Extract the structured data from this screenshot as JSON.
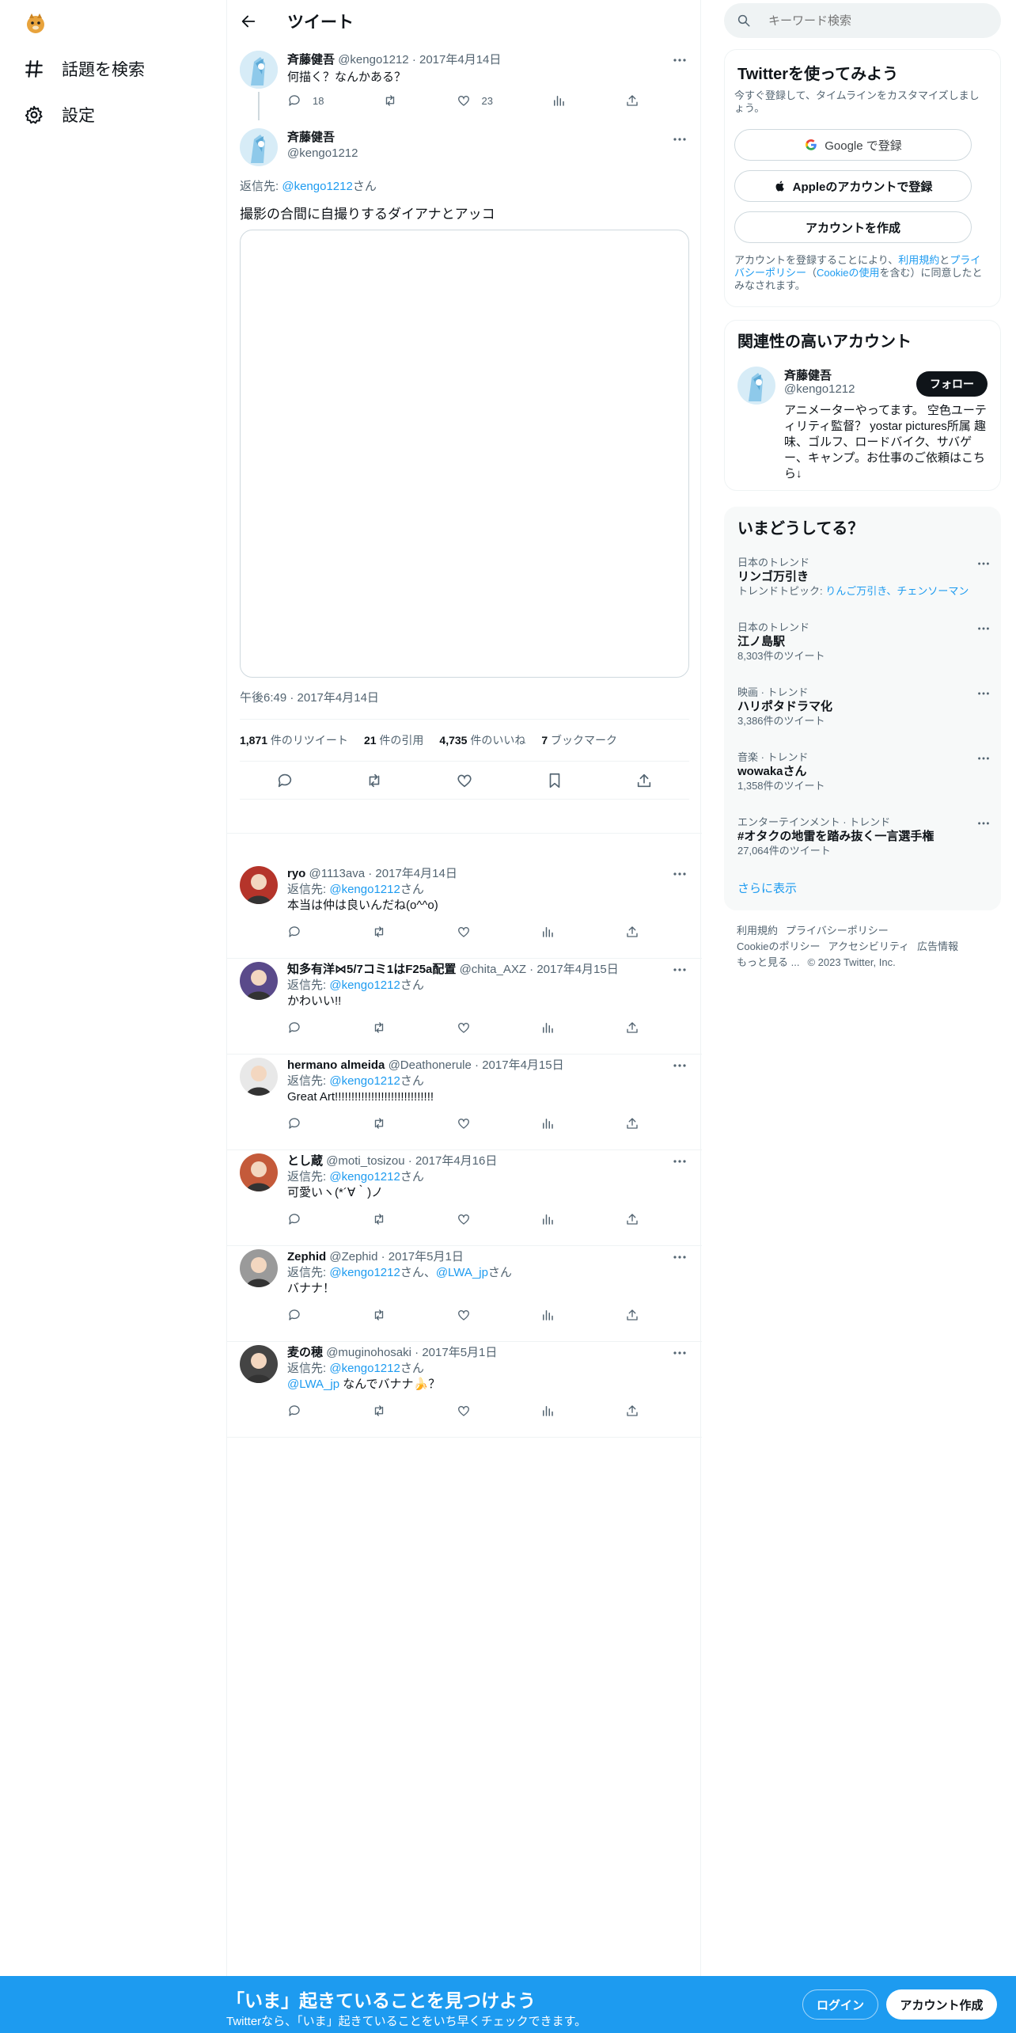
{
  "nav": {
    "explore_label": "話題を検索",
    "settings_label": "設定"
  },
  "header": {
    "title": "ツイート"
  },
  "parent_tweet": {
    "name": "斉藤健吾",
    "handle": "@kengo1212",
    "date": "2017年4月14日",
    "text": "何描く？なんかある？",
    "replies": "18",
    "likes": "23"
  },
  "main_tweet": {
    "name": "斉藤健吾",
    "handle": "@kengo1212",
    "reply_prefix": "返信先: ",
    "reply_to": "@kengo1212",
    "reply_suffix": "さん",
    "text": "撮影の合間に自撮りするダイアナとアッコ",
    "timestamp": "午後6:49 · 2017年4月14日",
    "retweets_n": "1,871",
    "retweets_l": " 件のリツイート",
    "quotes_n": "21",
    "quotes_l": " 件の引用",
    "likes_n": "4,735",
    "likes_l": " 件のいいね",
    "bookmarks_n": "7",
    "bookmarks_l": " ブックマーク"
  },
  "replies": [
    {
      "name": "ryo",
      "handle": "@1113ava",
      "date": "2017年4月14日",
      "reply_to": "@kengo1212",
      "reply_to2": "",
      "text": "本当は仲は良いんだね(o^^o)",
      "text_mention": "",
      "avatar": "#b5342a"
    },
    {
      "name": "知多有洋⋈5/7コミ1はF25a配置",
      "handle": "@chita_AXZ",
      "date": "2017年4月15日",
      "reply_to": "@kengo1212",
      "reply_to2": "",
      "text": "かわいい!!",
      "text_mention": "",
      "avatar": "#5a4a8a"
    },
    {
      "name": "hermano almeida",
      "handle": "@Deathonerule",
      "date": "2017年4月15日",
      "reply_to": "@kengo1212",
      "reply_to2": "",
      "text": "Great Art!!!!!!!!!!!!!!!!!!!!!!!!!!!!!!",
      "text_mention": "",
      "avatar": "#e8e8e8"
    },
    {
      "name": "とし蔵",
      "handle": "@moti_tosizou",
      "date": "2017年4月16日",
      "reply_to": "@kengo1212",
      "reply_to2": "",
      "text": "可愛いヽ(*´∀｀)ノ",
      "text_mention": "",
      "avatar": "#c45a3a"
    },
    {
      "name": "Zephid",
      "handle": "@Zephid",
      "date": "2017年5月1日",
      "reply_to": "@kengo1212",
      "reply_to2": "@LWA_jp",
      "text": "バナナ！",
      "text_mention": "",
      "avatar": "#9a9a9a"
    },
    {
      "name": "麦の穂",
      "handle": "@muginohosaki",
      "date": "2017年5月1日",
      "reply_to": "@kengo1212",
      "reply_to2": "",
      "text": " なんでバナナ🍌？",
      "text_mention": "@LWA_jp",
      "avatar": "#444"
    }
  ],
  "reply_labels": {
    "prefix": "返信先: ",
    "suffix": "さん",
    "joiner": "さん、",
    "dot": " · "
  },
  "search": {
    "placeholder": "キーワード検索"
  },
  "signup_card": {
    "title": "Twitterを使ってみよう",
    "subtitle": "今すぐ登録して、タイムラインをカスタマイズしましょう。",
    "google": "Google で登録",
    "apple": "Appleのアカウントで登録",
    "create": "アカウントを作成",
    "terms_pre": "アカウントを登録することにより、",
    "terms_link1": "利用規約",
    "terms_and": "と",
    "terms_link2": "プライバシーポリシー",
    "terms_paren_open": "（",
    "terms_link3": "Cookieの使用",
    "terms_post": "を含む）に同意したとみなされます。"
  },
  "related": {
    "title": "関連性の高いアカウント",
    "name": "斉藤健吾",
    "handle": "@kengo1212",
    "follow": "フォロー",
    "bio": "アニメーターやってます。 空色ユーティリティ監督？ yostar pictures所属 趣味、ゴルフ、ロードバイク、サバゲー、キャンプ。お仕事のご依頼はこちら↓"
  },
  "trends": {
    "title": "いまどうしてる？",
    "items": [
      {
        "cat": "日本のトレンド",
        "name": "リンゴ万引き",
        "sub_label": "トレンドトピック: ",
        "sub_link": "りんご万引き、チェンソーマン",
        "sub": ""
      },
      {
        "cat": "日本のトレンド",
        "name": "江ノ島駅",
        "sub_label": "",
        "sub_link": "",
        "sub": "8,303件のツイート"
      },
      {
        "cat": "映画 · トレンド",
        "name": "ハリポタドラマ化",
        "sub_label": "",
        "sub_link": "",
        "sub": "3,386件のツイート"
      },
      {
        "cat": "音楽 · トレンド",
        "name": "wowakaさん",
        "sub_label": "",
        "sub_link": "",
        "sub": "1,358件のツイート"
      },
      {
        "cat": "エンターテインメント · トレンド",
        "name": "#オタクの地雷を踏み抜く一言選手権",
        "sub_label": "",
        "sub_link": "",
        "sub": "27,064件のツイート"
      }
    ],
    "show_more": "さらに表示"
  },
  "footer": {
    "terms": "利用規約",
    "privacy": "プライバシーポリシー",
    "cookie": "Cookieのポリシー",
    "accessibility": "アクセシビリティ",
    "ads": "広告情報",
    "more": "もっと見る ...",
    "copyright": "© 2023 Twitter, Inc."
  },
  "bottom_bar": {
    "headline": "「いま」起きていることを見つけよう",
    "sub": "Twitterなら、「いま」起きていることをいち早くチェックできます。",
    "login": "ログイン",
    "signup": "アカウント作成"
  },
  "colors": {
    "accent": "#1d9bf0",
    "text": "#0f1419",
    "muted": "#536471"
  }
}
